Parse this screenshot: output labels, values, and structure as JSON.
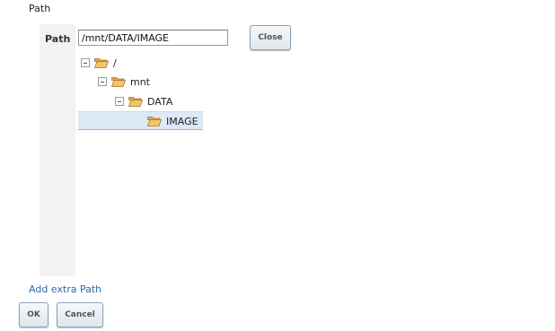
{
  "header": {
    "title": "Path"
  },
  "path_field": {
    "label": "Path",
    "value": "/mnt/DATA/IMAGE"
  },
  "buttons": {
    "close": "Close",
    "ok": "OK",
    "cancel": "Cancel"
  },
  "tree": {
    "nodes": [
      {
        "label": "/",
        "expanded": true,
        "icon": "folder-open-icon"
      },
      {
        "label": "mnt",
        "expanded": true,
        "icon": "folder-open-icon"
      },
      {
        "label": "DATA",
        "expanded": true,
        "icon": "folder-open-icon"
      },
      {
        "label": "IMAGE",
        "selected": true,
        "icon": "folder-open-icon"
      }
    ]
  },
  "links": {
    "add_extra_path": "Add extra Path"
  },
  "colors": {
    "selection": "#dce9f7",
    "link": "#2a6aa6",
    "folder": "#f5c36a"
  }
}
